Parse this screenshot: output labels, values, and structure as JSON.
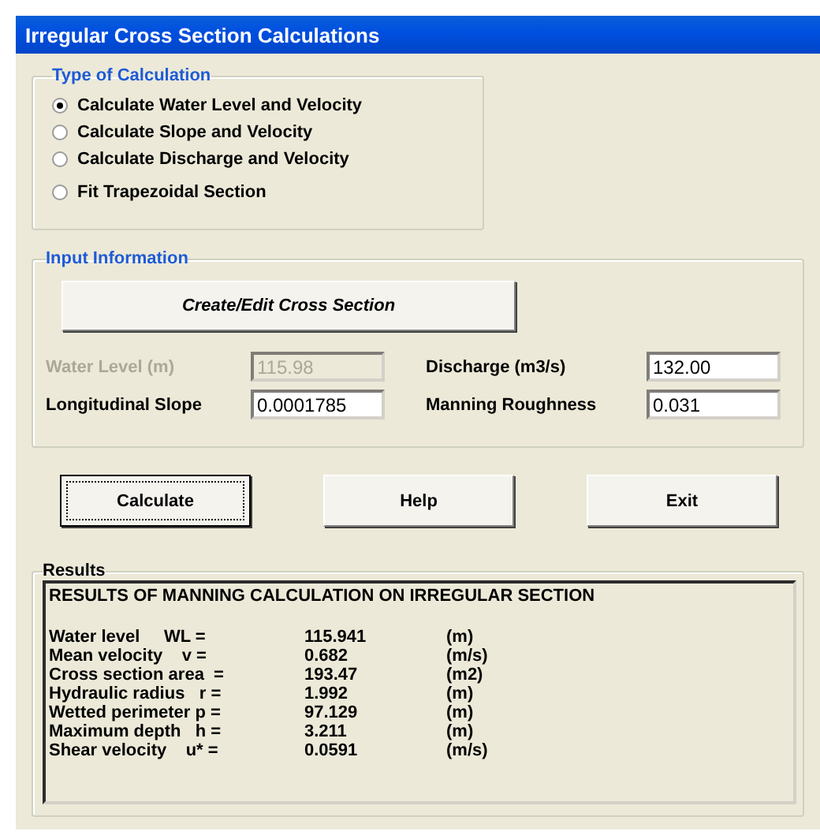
{
  "window": {
    "title": "Irregular Cross Section Calculations"
  },
  "calculation_type": {
    "title": "Type of Calculation",
    "options": [
      {
        "label": "Calculate Water Level and Velocity",
        "selected": true
      },
      {
        "label": "Calculate Slope and Velocity",
        "selected": false
      },
      {
        "label": "Calculate Discharge and Velocity",
        "selected": false
      },
      {
        "label": "Fit Trapezoidal Section",
        "selected": false
      }
    ]
  },
  "input_information": {
    "title": "Input Information",
    "create_button": "Create/Edit Cross Section",
    "fields": [
      {
        "label": "Water Level (m)",
        "value": "115.98",
        "disabled": true
      },
      {
        "label": "Discharge (m3/s)",
        "value": "132.00",
        "disabled": false
      },
      {
        "label": "Longitudinal Slope",
        "value": "0.0001785",
        "disabled": false
      },
      {
        "label": "Manning Roughness",
        "value": "0.031",
        "disabled": false
      }
    ]
  },
  "buttons": [
    {
      "label": "Calculate",
      "focused": true
    },
    {
      "label": "Help",
      "focused": false
    },
    {
      "label": "Exit",
      "focused": false
    }
  ],
  "results": {
    "title": "Results",
    "heading": "RESULTS OF MANNING CALCULATION ON IRREGULAR SECTION",
    "rows": [
      {
        "label": "Water level     WL =",
        "value": "115.941",
        "unit": "(m)"
      },
      {
        "label": "Mean velocity    v =",
        "value": "0.682",
        "unit": "(m/s)"
      },
      {
        "label": "Cross section area  =",
        "value": "193.47",
        "unit": "(m2)"
      },
      {
        "label": "Hydraulic radius   r =",
        "value": "1.992",
        "unit": "(m)"
      },
      {
        "label": "Wetted perimeter p =",
        "value": "97.129",
        "unit": "(m)"
      },
      {
        "label": "Maximum depth   h =",
        "value": "3.211",
        "unit": "(m)"
      },
      {
        "label": "Shear velocity    u* =",
        "value": "0.0591",
        "unit": "(m/s)"
      }
    ]
  }
}
